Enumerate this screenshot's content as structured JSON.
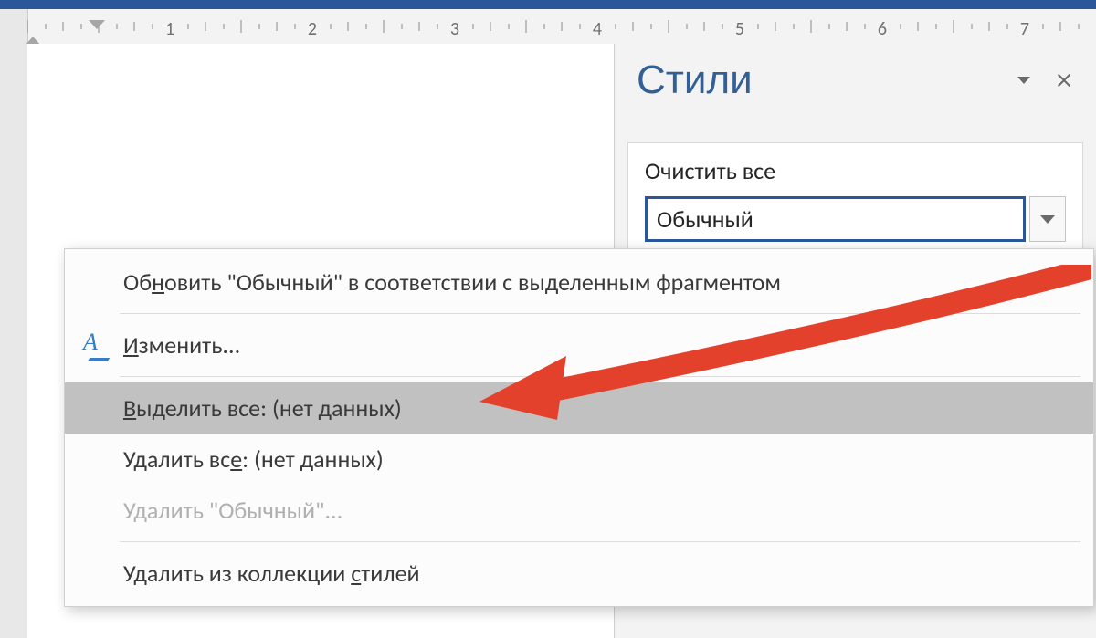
{
  "ruler": {
    "numbers": [
      "1",
      "2",
      "3",
      "4",
      "5",
      "6",
      "7"
    ]
  },
  "styles_pane": {
    "title": "Стили",
    "clear_all": "Очистить все",
    "selected_style": "Обычный"
  },
  "context_menu": {
    "update_pre": "Об",
    "update_u": "н",
    "update_post": "овить \"Обычный\" в соответствии с выделенным фрагментом",
    "modify_u": "И",
    "modify_post": "зменить...",
    "select_all_u": "В",
    "select_all_post": "ыделить все: (нет данных)",
    "remove_all_pre": "Удалить вс",
    "remove_all_u": "е",
    "remove_all_post": ": (нет данных)",
    "delete_style": "Удалить \"Обычный\"...",
    "remove_gallery_pre": "Удалить из коллекции ",
    "remove_gallery_u": "с",
    "remove_gallery_post": "тилей"
  }
}
